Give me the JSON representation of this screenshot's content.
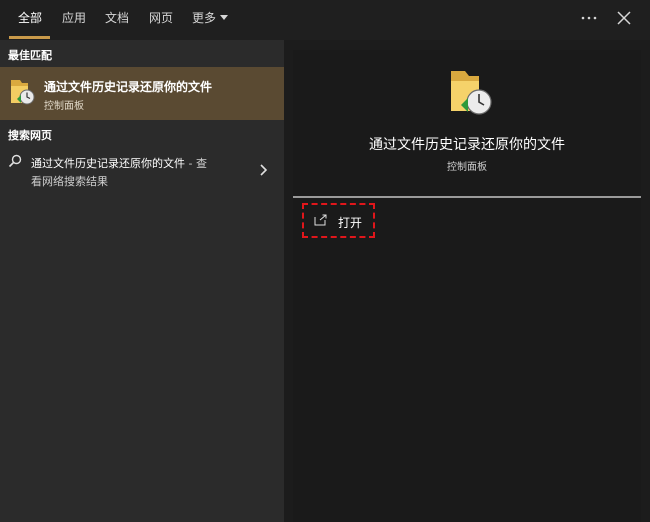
{
  "tabs": [
    {
      "label": "全部",
      "active": true
    },
    {
      "label": "应用",
      "active": false
    },
    {
      "label": "文档",
      "active": false
    },
    {
      "label": "网页",
      "active": false
    },
    {
      "label": "更多",
      "active": false
    }
  ],
  "toolbar": {
    "more_options_icon": "ellipsis-icon",
    "close_icon": "close-icon"
  },
  "left": {
    "best_match_heading": "最佳匹配",
    "best_match": {
      "title": "通过文件历史记录还原你的文件",
      "subtitle": "控制面板",
      "icon": "folder-clock-icon"
    },
    "web_heading": "搜索网页",
    "web_result": {
      "query": "通过文件历史记录还原你的文件",
      "suffix": " - 查",
      "line2": "看网络搜索结果",
      "icon": "search-icon"
    }
  },
  "preview": {
    "title": "通过文件历史记录还原你的文件",
    "subtitle": "控制面板",
    "actions": [
      {
        "label": "打开",
        "icon": "open-window-icon"
      }
    ]
  },
  "colors": {
    "accent": "#c99a4a",
    "selected_bg": "#5a4a32",
    "highlight_border": "#e0161b"
  }
}
